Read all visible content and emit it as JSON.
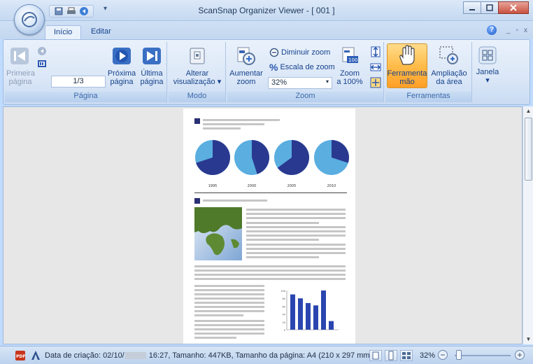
{
  "window": {
    "title": "ScanSnap Organizer Viewer - [ 001 ]"
  },
  "tabs": [
    {
      "label": "Início",
      "active": true
    },
    {
      "label": "Editar",
      "active": false
    }
  ],
  "ribbon": {
    "pagina": {
      "group_label": "Página",
      "first_label_1": "Primeira",
      "first_label_2": "página",
      "page_field": "1/3",
      "next_label_1": "Próxima",
      "next_label_2": "página",
      "last_label_1": "Última",
      "last_label_2": "página"
    },
    "modo": {
      "group_label": "Modo",
      "change_label_1": "Alterar",
      "change_label_2": "visualização ▾"
    },
    "zoom": {
      "group_label": "Zoom",
      "increase_label_1": "Aumentar",
      "increase_label_2": "zoom",
      "decrease_label": "Diminuir zoom",
      "scale_label": "Escala de zoom",
      "zoom_value": "32%",
      "zoom100_label_1": "Zoom",
      "zoom100_label_2": "a 100%"
    },
    "ferramentas": {
      "group_label": "Ferramentas",
      "hand_label_1": "Ferramenta",
      "hand_label_2": "mão",
      "area_label_1": "Ampliação",
      "area_label_2": "da área"
    },
    "janela": {
      "label": "Janela",
      "arrow": "▾"
    }
  },
  "document": {
    "pie_years": [
      "1995",
      "2000",
      "2005",
      "2010"
    ],
    "pie_dark_fraction": [
      0.7,
      0.45,
      0.65,
      0.3
    ],
    "bar_values": [
      90,
      80,
      68,
      62,
      100,
      22
    ],
    "bar_axis_ticks": [
      "100",
      "80",
      "60",
      "40",
      "20",
      "0"
    ]
  },
  "status": {
    "date_prefix": "Data de criação: 02/10/",
    "date_suffix": " 16:27, Tamanho: 447KB, Tamanho da página: A4 (210 x 297 mm)",
    "zoom": "32%"
  },
  "colors": {
    "pie_light": "#5aaee0",
    "pie_dark": "#2a3990",
    "bars": "#2b45b0"
  }
}
